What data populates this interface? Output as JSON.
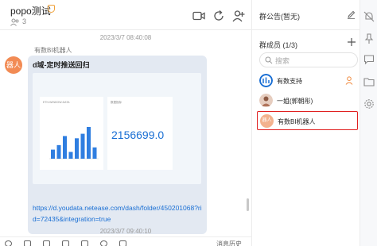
{
  "chat": {
    "title": "popo测试",
    "member_count": "3",
    "messages": [
      {
        "timestamp": "2023/3/7 08:40:08",
        "sender": "有数BI机器人",
        "avatar_text": "器人",
        "title": "d域-定时推送回归",
        "dashboard": {
          "card1_caption": "ETH-WINDOW-DATA",
          "card2_caption": "数据指标",
          "big_number": "2156699.0",
          "bar_values": [
            4,
            6,
            10,
            3,
            9,
            11,
            14,
            5
          ]
        },
        "link": "https://d.youdata.netease.com/dash/folder/450201068?rid=72435&integration=true"
      }
    ],
    "bottom_timestamp": "2023/3/7 09:40:10",
    "toolbar": {
      "history_label": "消息历史"
    }
  },
  "panel": {
    "notice_label": "群公告(暂无)",
    "members_label": "群成员 (1/3)",
    "search_placeholder": "搜索",
    "members": [
      {
        "name": "有数支持",
        "avatar_color": "#1a6fd4",
        "badge": "person-icon"
      },
      {
        "name": "一姐(郭朝彤)",
        "avatar_color": "#c9a08a",
        "badge": ""
      },
      {
        "name": "有数BI机器人",
        "avatar_color": "#f3b28e",
        "avatar_text": "器人",
        "badge": "",
        "selected": true
      }
    ]
  },
  "colors": {
    "accent": "#1a6fd4",
    "bot_avatar": "#f28b54",
    "bubble": "#e3e9f2",
    "selection": "#e02020"
  }
}
